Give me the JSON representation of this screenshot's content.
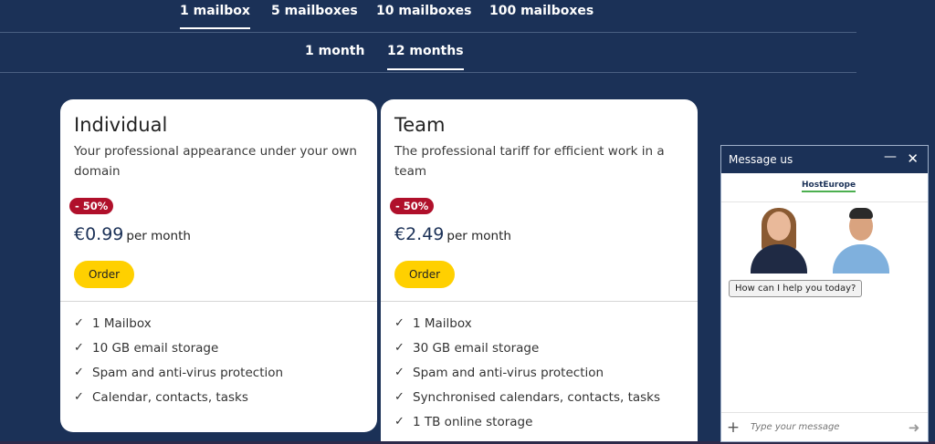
{
  "mailbox_tabs": [
    {
      "label": "1 mailbox",
      "active": true
    },
    {
      "label": "5 mailboxes",
      "active": false
    },
    {
      "label": "10 mailboxes",
      "active": false
    },
    {
      "label": "100 mailboxes",
      "active": false
    }
  ],
  "period_tabs": [
    {
      "label": "1 month",
      "active": false
    },
    {
      "label": "12 months",
      "active": true
    }
  ],
  "plans": [
    {
      "title": "Individual",
      "description": "Your professional appearance under your own domain",
      "discount": "- 50%",
      "price": "€0.99",
      "per": "per month",
      "order_label": "Order",
      "features": [
        "1 Mailbox",
        "10 GB email storage",
        "Spam and anti-virus protection",
        "Calendar, contacts, tasks"
      ]
    },
    {
      "title": "Team",
      "description": "The professional tariff for efficient work in a team",
      "discount": "- 50%",
      "price": "€2.49",
      "per": "per month",
      "order_label": "Order",
      "features": [
        "1 Mailbox",
        "30 GB email storage",
        "Spam and anti-virus protection",
        "Synchronised calendars, contacts, tasks",
        "1 TB online storage"
      ]
    }
  ],
  "chat": {
    "title": "Message us",
    "minimize_icon": "minimize-icon",
    "close_icon": "close-icon",
    "logo": "HostEurope",
    "greeting": "How can I help you today?",
    "input_placeholder": "Type your message",
    "add_icon": "plus-icon",
    "send_icon": "send-arrow-icon"
  },
  "colors": {
    "background": "#1b3157",
    "accent": "#ffd000",
    "badge": "#b0102b"
  }
}
